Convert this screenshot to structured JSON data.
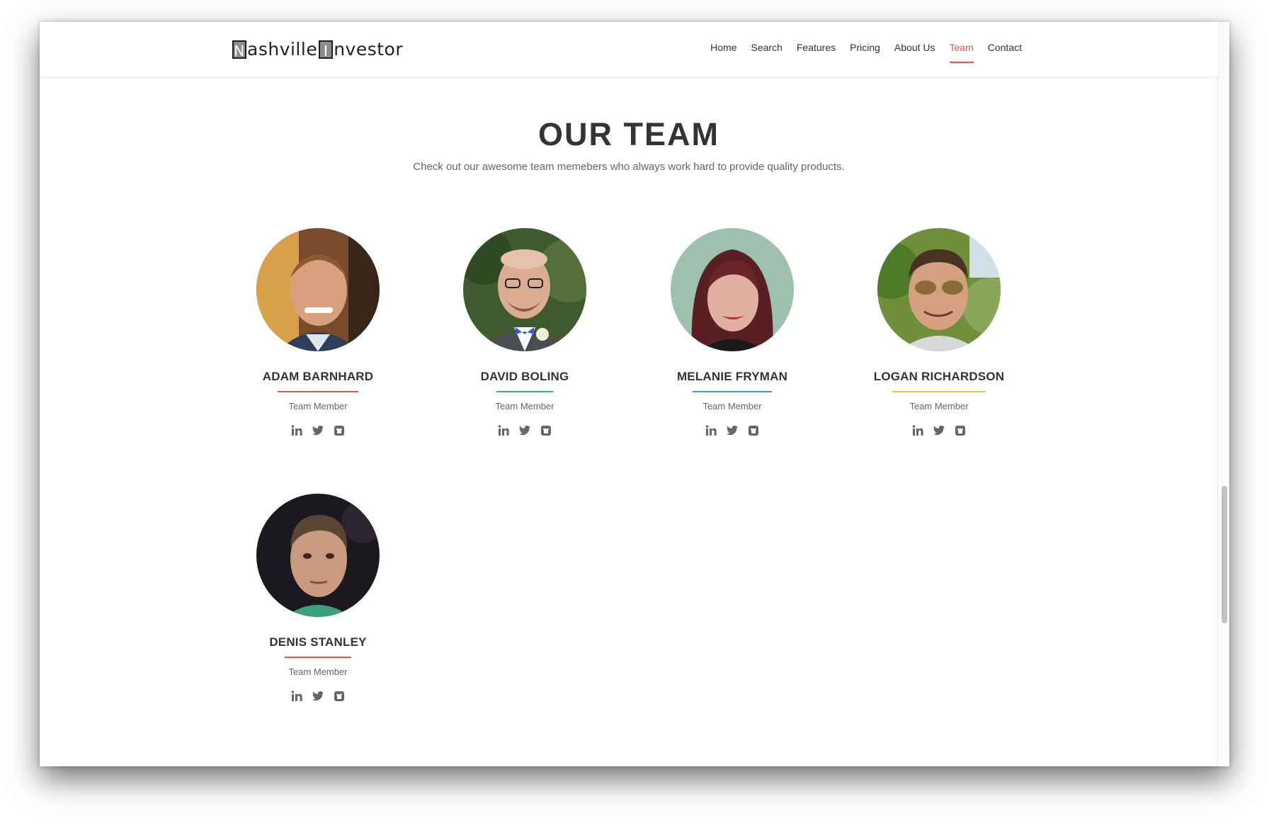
{
  "header": {
    "logo_letter_1": "N",
    "logo_text_1": "ashville",
    "logo_letter_2": "I",
    "logo_text_2": "nvestor",
    "nav": [
      {
        "label": "Home"
      },
      {
        "label": "Search"
      },
      {
        "label": "Features"
      },
      {
        "label": "Pricing"
      },
      {
        "label": "About Us"
      },
      {
        "label": "Team",
        "active": true
      },
      {
        "label": "Contact"
      }
    ]
  },
  "team": {
    "title": "OUR TEAM",
    "subtitle": "Check out our awesome team memebers who always work hard to provide quality products.",
    "members": [
      {
        "name": "ADAM BARNHARD",
        "role": "Team Member",
        "accent": "#e05a42",
        "icons": [
          "linkedin-icon",
          "twitter-icon",
          "github-icon"
        ]
      },
      {
        "name": "DAVID BOLING",
        "role": "Team Member",
        "accent": "#2bb58a",
        "icons": [
          "linkedin-icon",
          "twitter-icon",
          "github-icon"
        ]
      },
      {
        "name": "MELANIE FRYMAN",
        "role": "Team Member",
        "accent": "#3a9bd9",
        "icons": [
          "linkedin-icon",
          "twitter-icon",
          "github-icon"
        ]
      },
      {
        "name": "LOGAN RICHARDSON",
        "role": "Team Member",
        "accent": "#e8c53a",
        "icons": [
          "linkedin-icon",
          "twitter-icon",
          "github-icon"
        ]
      },
      {
        "name": "DENIS STANLEY",
        "role": "Team Member",
        "accent": "#e05a42",
        "icons": [
          "linkedin-icon",
          "twitter-icon",
          "github-icon"
        ]
      }
    ]
  },
  "colors": {
    "active_nav": "#e05a42",
    "icon": "#666666",
    "heading": "#333333"
  }
}
